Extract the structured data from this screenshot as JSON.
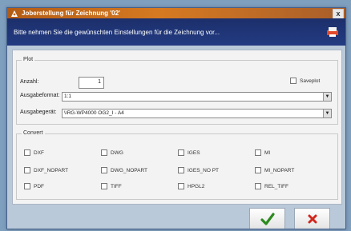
{
  "window": {
    "title": "Joberstellung für Zeichnung '02'",
    "close_label": "x"
  },
  "banner": {
    "text": "Bitte nehmen Sie die gewünschten Einstellungen für die Zeichnung vor..."
  },
  "plot": {
    "legend": "Plot",
    "count_label": "Anzahl:",
    "count_value": "1",
    "format_label": "Ausgabeformat:",
    "format_value": "1:1",
    "device_label": "Ausgabegerät:",
    "device_value": "\\\\RG-WP4000 OG2_I - A4",
    "saveplot_label": "Saveplot"
  },
  "convert": {
    "legend": "Convert",
    "options": [
      "DXF",
      "DWG",
      "IGES",
      "MI",
      "DXF_NOPART",
      "DWG_NOPART",
      "IGES_NO PT",
      "MI_NOPART",
      "PDF",
      "TIFF",
      "HPGL2",
      "REL_TIFF"
    ]
  },
  "buttons": {
    "ok_icon": "checkmark-icon",
    "cancel_icon": "cross-icon"
  },
  "colors": {
    "title_bar": "#c46a1c",
    "banner": "#1f3575",
    "ok": "#2c8a1e",
    "cancel": "#d0281e"
  }
}
